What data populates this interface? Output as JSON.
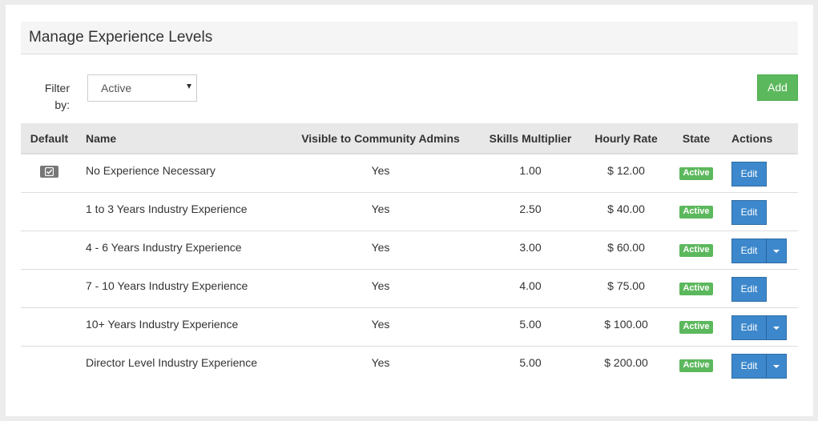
{
  "page": {
    "title": "Manage Experience Levels"
  },
  "filter": {
    "label": "Filter by:",
    "selected": "Active"
  },
  "toolbar": {
    "add_label": "Add"
  },
  "table": {
    "headers": {
      "default": "Default",
      "name": "Name",
      "visible": "Visible to Community Admins",
      "multiplier": "Skills Multiplier",
      "rate": "Hourly Rate",
      "state": "State",
      "actions": "Actions"
    },
    "edit_label": "Edit",
    "rows": [
      {
        "is_default": true,
        "name": "No Experience Necessary",
        "visible": "Yes",
        "multiplier": "1.00",
        "rate": "$ 12.00",
        "state": "Active",
        "has_dropdown": false
      },
      {
        "is_default": false,
        "name": "1 to 3 Years Industry Experience",
        "visible": "Yes",
        "multiplier": "2.50",
        "rate": "$ 40.00",
        "state": "Active",
        "has_dropdown": false
      },
      {
        "is_default": false,
        "name": "4 - 6 Years Industry Experience",
        "visible": "Yes",
        "multiplier": "3.00",
        "rate": "$ 60.00",
        "state": "Active",
        "has_dropdown": true
      },
      {
        "is_default": false,
        "name": "7 - 10 Years Industry Experience",
        "visible": "Yes",
        "multiplier": "4.00",
        "rate": "$ 75.00",
        "state": "Active",
        "has_dropdown": false
      },
      {
        "is_default": false,
        "name": "10+ Years Industry Experience",
        "visible": "Yes",
        "multiplier": "5.00",
        "rate": "$ 100.00",
        "state": "Active",
        "has_dropdown": true
      },
      {
        "is_default": false,
        "name": "Director Level Industry Experience",
        "visible": "Yes",
        "multiplier": "5.00",
        "rate": "$ 200.00",
        "state": "Active",
        "has_dropdown": true
      }
    ]
  },
  "colors": {
    "add_button": "#5cb85c",
    "edit_button": "#3d88cc",
    "active_badge": "#5cb85c",
    "default_icon_bg": "#777777"
  },
  "icons": {
    "default_marker": "checkbox-checked-icon",
    "dropdown": "caret-down-icon"
  }
}
